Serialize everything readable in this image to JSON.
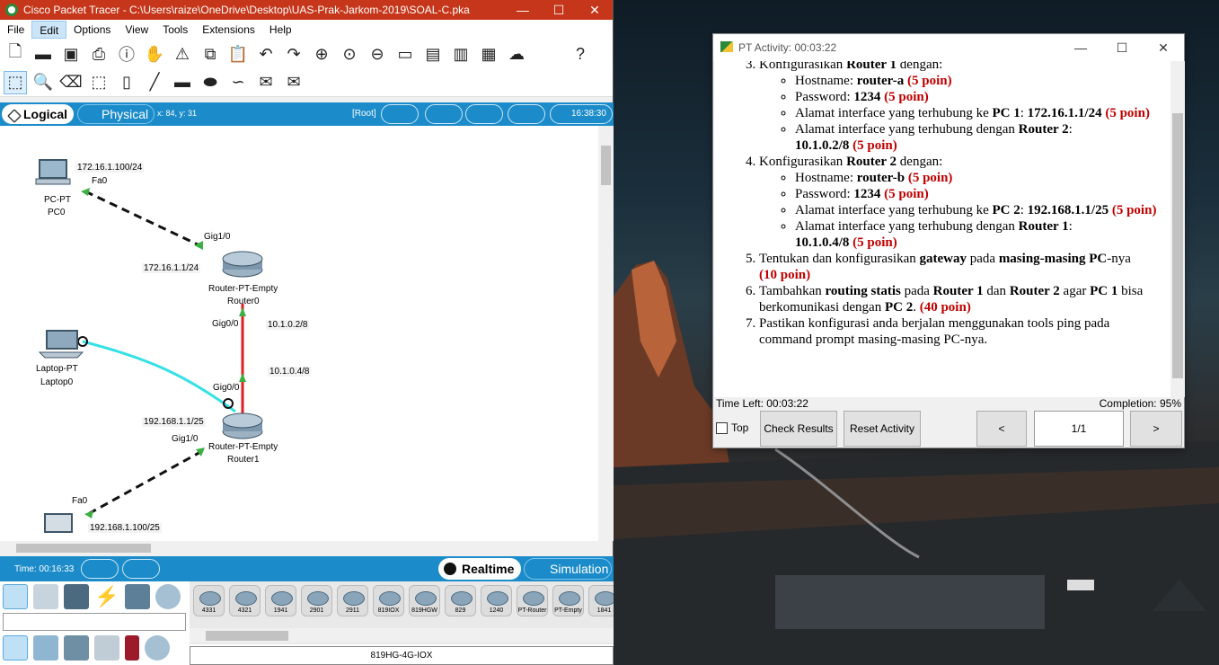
{
  "pt": {
    "title": "Cisco Packet Tracer - C:\\Users\\raize\\OneDrive\\Desktop\\UAS-Prak-Jarkom-2019\\SOAL-C.pka",
    "window_buttons": [
      "—",
      "☐",
      "✕"
    ],
    "menu": [
      "File",
      "Edit",
      "Options",
      "View",
      "Tools",
      "Extensions",
      "Help"
    ],
    "logical": "Logical",
    "physical": "Physical",
    "coords": "x: 84, y: 31",
    "root": "[Root]",
    "clock": "16:38:30",
    "time": "Time: 00:16:33",
    "realtime": "Realtime",
    "simulation": "Simulation",
    "selected_device": "819HG-4G-IOX",
    "devices": [
      "4331",
      "4321",
      "1941",
      "2901",
      "2911",
      "819IOX",
      "819HGW",
      "829",
      "1240",
      "PT-Router",
      "PT-Empty",
      "1841"
    ]
  },
  "topology": {
    "pc0_type": "PC-PT",
    "pc0_name": "PC0",
    "pc0_ip": "172.16.1.100/24",
    "pc0_port": "Fa0",
    "r0_port_pc": "Gig1/0",
    "r0_ip_pc": "172.16.1.1/24",
    "r0_type": "Router-PT-Empty",
    "r0_name": "Router0",
    "r0_port_r1": "Gig0/0",
    "r0_ip_r1": "10.1.0.2/8",
    "r1_ip_r0": "10.1.0.4/8",
    "laptop_type": "Laptop-PT",
    "laptop_name": "Laptop0",
    "r1_port_r0": "Gig0/0",
    "r1_ip_pc": "192.168.1.1/25",
    "r1_port_pc": "Gig1/0",
    "r1_type": "Router-PT-Empty",
    "r1_name": "Router1",
    "pc1_port": "Fa0",
    "pc1_ip": "192.168.1.100/25"
  },
  "activity": {
    "title": "PT Activity: 00:03:22",
    "window_buttons": [
      "—",
      "☐",
      "✕"
    ],
    "time_left": "Time Left: 00:03:22",
    "completion": "Completion: 95%",
    "top": "Top",
    "check_results": "Check Results",
    "reset_activity": "Reset Activity",
    "prev": "<",
    "page": "1/1",
    "next": ">",
    "items": {
      "i3": {
        "pre": "Konfigurasikan ",
        "b1": "Router 1",
        "post": " dengan:",
        "sub": [
          {
            "t1": "Hostname: ",
            "b": "router-a",
            "r": " (5 poin)"
          },
          {
            "t1": "Password: ",
            "b": "1234",
            "r": " (5 poin)"
          },
          {
            "t1": "Alamat interface yang terhubung ke ",
            "b1": "PC 1",
            "t2": ": ",
            "b": "172.16.1.1/24",
            "r": " (5 poin)"
          },
          {
            "t1": "Alamat interface yang terhubung dengan ",
            "b1": "Router 2",
            "t2": ": ",
            "b": "10.1.0.2/8",
            "r": " (5 poin)"
          }
        ]
      },
      "i4": {
        "pre": "Konfigurasikan ",
        "b1": "Router 2",
        "post": " dengan:",
        "sub": [
          {
            "t1": "Hostname: ",
            "b": "router-b",
            "r": " (5 poin)"
          },
          {
            "t1": "Password: ",
            "b": "1234",
            "r": " (5 poin)"
          },
          {
            "t1": "Alamat interface yang terhubung ke ",
            "b1": "PC 2",
            "t2": ": ",
            "b": "192.168.1.1/25",
            "r": " (5 poin)"
          },
          {
            "t1": "Alamat interface yang terhubung dengan ",
            "b1": "Router 1",
            "t2": ": ",
            "b": "10.1.0.4/8",
            "r": " (5 poin)"
          }
        ]
      },
      "i5": {
        "t1": "Tentukan dan konfigurasikan ",
        "b1": "gateway",
        "t2": " pada ",
        "b2": "masing-masing PC",
        "t3": "-nya",
        "r": " (10 poin)"
      },
      "i6": {
        "t1": "Tambahkan ",
        "b1": "routing statis",
        "t2": " pada ",
        "b2": "Router 1",
        "t3": " dan ",
        "b3": "Router 2",
        "t4": " agar ",
        "b4": "PC 1",
        "t5": " bisa berkomunikasi dengan ",
        "b5": "PC 2",
        "t6": ".",
        "r": " (40 poin)"
      },
      "i7": {
        "t1": "Pastikan konfigurasi anda berjalan menggunakan tools ping pada command prompt masing-masing PC-nya."
      }
    }
  },
  "colors": {
    "pt_title": "#c5361a",
    "pt_blue": "#1b8bc9",
    "link_router": "#e02020",
    "link_wireless": "#35e0e6",
    "port_up": "#3cb043",
    "points_red": "#c00000"
  }
}
